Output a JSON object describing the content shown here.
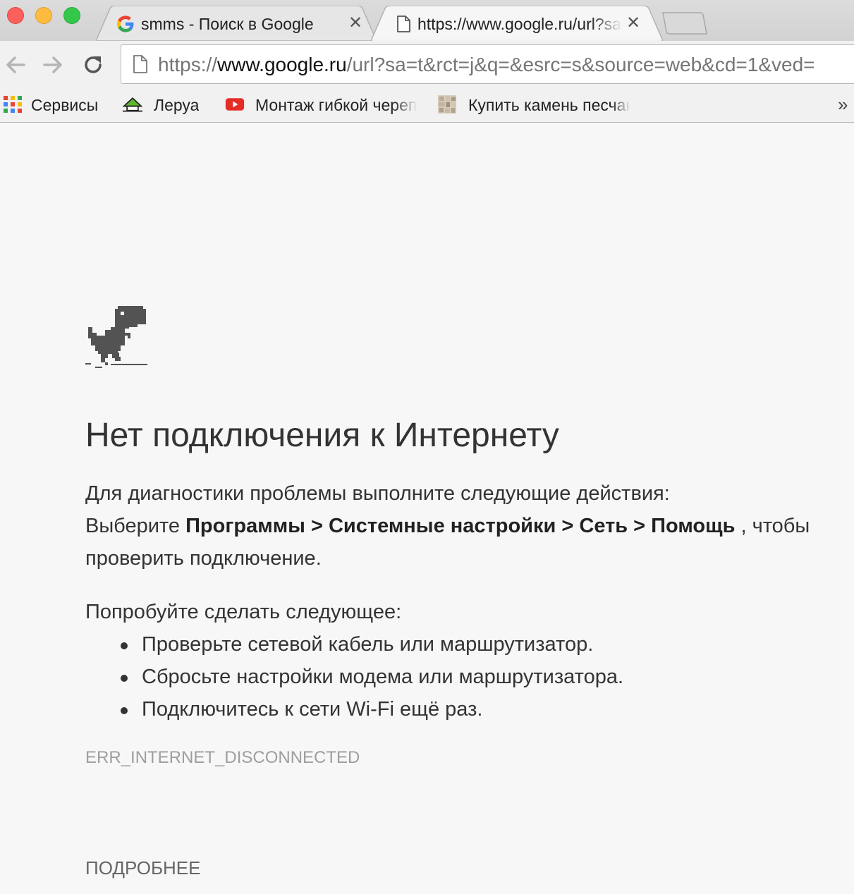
{
  "tabs": [
    {
      "title": "smms - Поиск в Google",
      "close": "✕",
      "icon": "google-g-icon"
    },
    {
      "title": "https://www.google.ru/url?sa",
      "close": "✕",
      "icon": "page-icon"
    }
  ],
  "omnibox": {
    "scheme": "https://",
    "host": "www.google.ru",
    "path": "/url?sa=t&rct=j&q=&esrc=s&source=web&cd=1&ved="
  },
  "bookmarks": [
    {
      "label": "Сервисы",
      "icon": "apps-grid-icon"
    },
    {
      "label": "Леруа",
      "icon": "lerua-house-icon"
    },
    {
      "label": "Монтаж гибкой черепицы",
      "icon": "youtube-icon"
    },
    {
      "label": "Купить камень песчаник",
      "icon": "stone-thumbnail-icon"
    }
  ],
  "bookmarks_overflow": "»",
  "page": {
    "heading": "Нет подключения к Интернету",
    "diag_line": "Для диагностики проблемы выполните следующие действия:",
    "diag_choose": "Выберите",
    "diag_path": "Программы > Системные настройки > Сеть > Помощь",
    "diag_end": ", чтобы проверить подключение.",
    "suggest_title": "Попробуйте сделать следующее:",
    "suggestions": [
      "Проверьте сетевой кабель или маршрутизатор.",
      "Сбросьте настройки модема или маршрутизатора.",
      "Подключитесь к сети Wi-Fi ещё раз."
    ],
    "error_code": "ERR_INTERNET_DISCONNECTED",
    "details_button": "ПОДРОБНЕЕ"
  },
  "colors": {
    "close_red": "#fc605b",
    "minimize_yellow": "#fdbc40",
    "zoom_green": "#34c84a",
    "page_background": "#f7f7f7",
    "dino": "#535353"
  }
}
